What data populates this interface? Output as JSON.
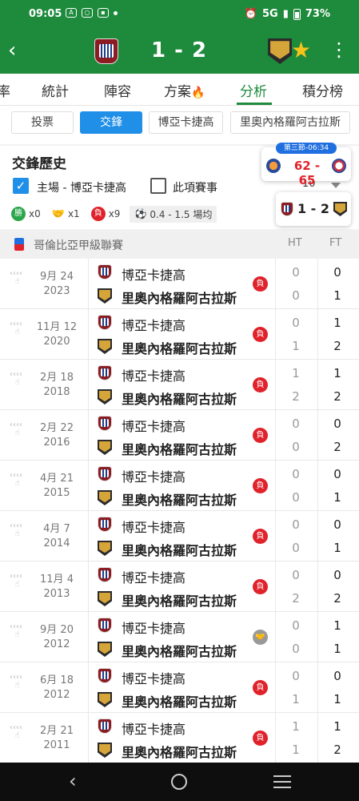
{
  "status": {
    "time": "09:05",
    "network": "5G",
    "battery": "73%",
    "icons": [
      "ai-icon",
      "instagram-icon",
      "app-icon",
      "dot-icon"
    ]
  },
  "header": {
    "score": "1 - 2",
    "back_icon": "back-arrow-icon",
    "star_icon": "star-icon",
    "menu_icon": "kebab-menu-icon",
    "color": "#1e8a3c"
  },
  "tabs": [
    {
      "label": "率"
    },
    {
      "label": "統計"
    },
    {
      "label": "陣容"
    },
    {
      "label": "方案"
    },
    {
      "label": "分析"
    },
    {
      "label": "積分榜"
    }
  ],
  "fire_icon": "🔥",
  "chips": [
    {
      "label": "投票"
    },
    {
      "label": "交鋒"
    },
    {
      "label": "博亞卡捷高"
    },
    {
      "label": "里奧內格羅阿古拉斯"
    }
  ],
  "h2h": {
    "title": "交鋒歷史",
    "filter_home": "主場 - 博亞卡捷高",
    "filter_comp": "此項賽事",
    "count": "10",
    "win_badge": "勝",
    "wins": "x0",
    "draws": "x1",
    "loss_badge": "負",
    "losses": "x9",
    "goals_range": "0.4 - 1.5 場均"
  },
  "live": {
    "badge": "第三節-06:34",
    "score": "62 - 65"
  },
  "mini": {
    "score": "1 - 2"
  },
  "league": {
    "name": "哥倫比亞甲級聯賽",
    "col_ht": "HT",
    "col_ft": "FT"
  },
  "matches": [
    {
      "month_day": "9月 24",
      "year": "2023",
      "home": "博亞卡捷高",
      "away": "里奧內格羅阿古拉斯",
      "result": "負",
      "ht_home": "0",
      "ht_away": "0",
      "ft_home": "0",
      "ft_away": "1"
    },
    {
      "month_day": "11月 12",
      "year": "2020",
      "home": "博亞卡捷高",
      "away": "里奧內格羅阿古拉斯",
      "result": "負",
      "ht_home": "0",
      "ht_away": "1",
      "ft_home": "1",
      "ft_away": "2"
    },
    {
      "month_day": "2月 18",
      "year": "2018",
      "home": "博亞卡捷高",
      "away": "里奧內格羅阿古拉斯",
      "result": "負",
      "ht_home": "1",
      "ht_away": "2",
      "ft_home": "1",
      "ft_away": "2"
    },
    {
      "month_day": "2月 22",
      "year": "2016",
      "home": "博亞卡捷高",
      "away": "里奧內格羅阿古拉斯",
      "result": "負",
      "ht_home": "0",
      "ht_away": "0",
      "ft_home": "0",
      "ft_away": "2"
    },
    {
      "month_day": "4月 21",
      "year": "2015",
      "home": "博亞卡捷高",
      "away": "里奧內格羅阿古拉斯",
      "result": "負",
      "ht_home": "0",
      "ht_away": "0",
      "ft_home": "0",
      "ft_away": "1"
    },
    {
      "month_day": "4月 7",
      "year": "2014",
      "home": "博亞卡捷高",
      "away": "里奧內格羅阿古拉斯",
      "result": "負",
      "ht_home": "0",
      "ht_away": "0",
      "ft_home": "0",
      "ft_away": "1"
    },
    {
      "month_day": "11月 4",
      "year": "2013",
      "home": "博亞卡捷高",
      "away": "里奧內格羅阿古拉斯",
      "result": "負",
      "ht_home": "0",
      "ht_away": "2",
      "ft_home": "0",
      "ft_away": "2"
    },
    {
      "month_day": "9月 20",
      "year": "2012",
      "home": "博亞卡捷高",
      "away": "里奧內格羅阿古拉斯",
      "result": "draw",
      "ht_home": "0",
      "ht_away": "0",
      "ft_home": "1",
      "ft_away": "1"
    },
    {
      "month_day": "6月 18",
      "year": "2012",
      "home": "博亞卡捷高",
      "away": "里奧內格羅阿古拉斯",
      "result": "負",
      "ht_home": "0",
      "ht_away": "1",
      "ft_home": "0",
      "ft_away": "1"
    },
    {
      "month_day": "2月 21",
      "year": "2011",
      "home": "博亞卡捷高",
      "away": "里奧內格羅阿古拉斯",
      "result": "負",
      "ht_home": "1",
      "ht_away": "1",
      "ft_home": "1",
      "ft_away": "2"
    }
  ],
  "colors": {
    "accent_green": "#1e8a3c",
    "accent_blue": "#1f8fe8",
    "loss_red": "#e0222b",
    "win_green": "#2aa64a",
    "star": "#f7c31a"
  }
}
